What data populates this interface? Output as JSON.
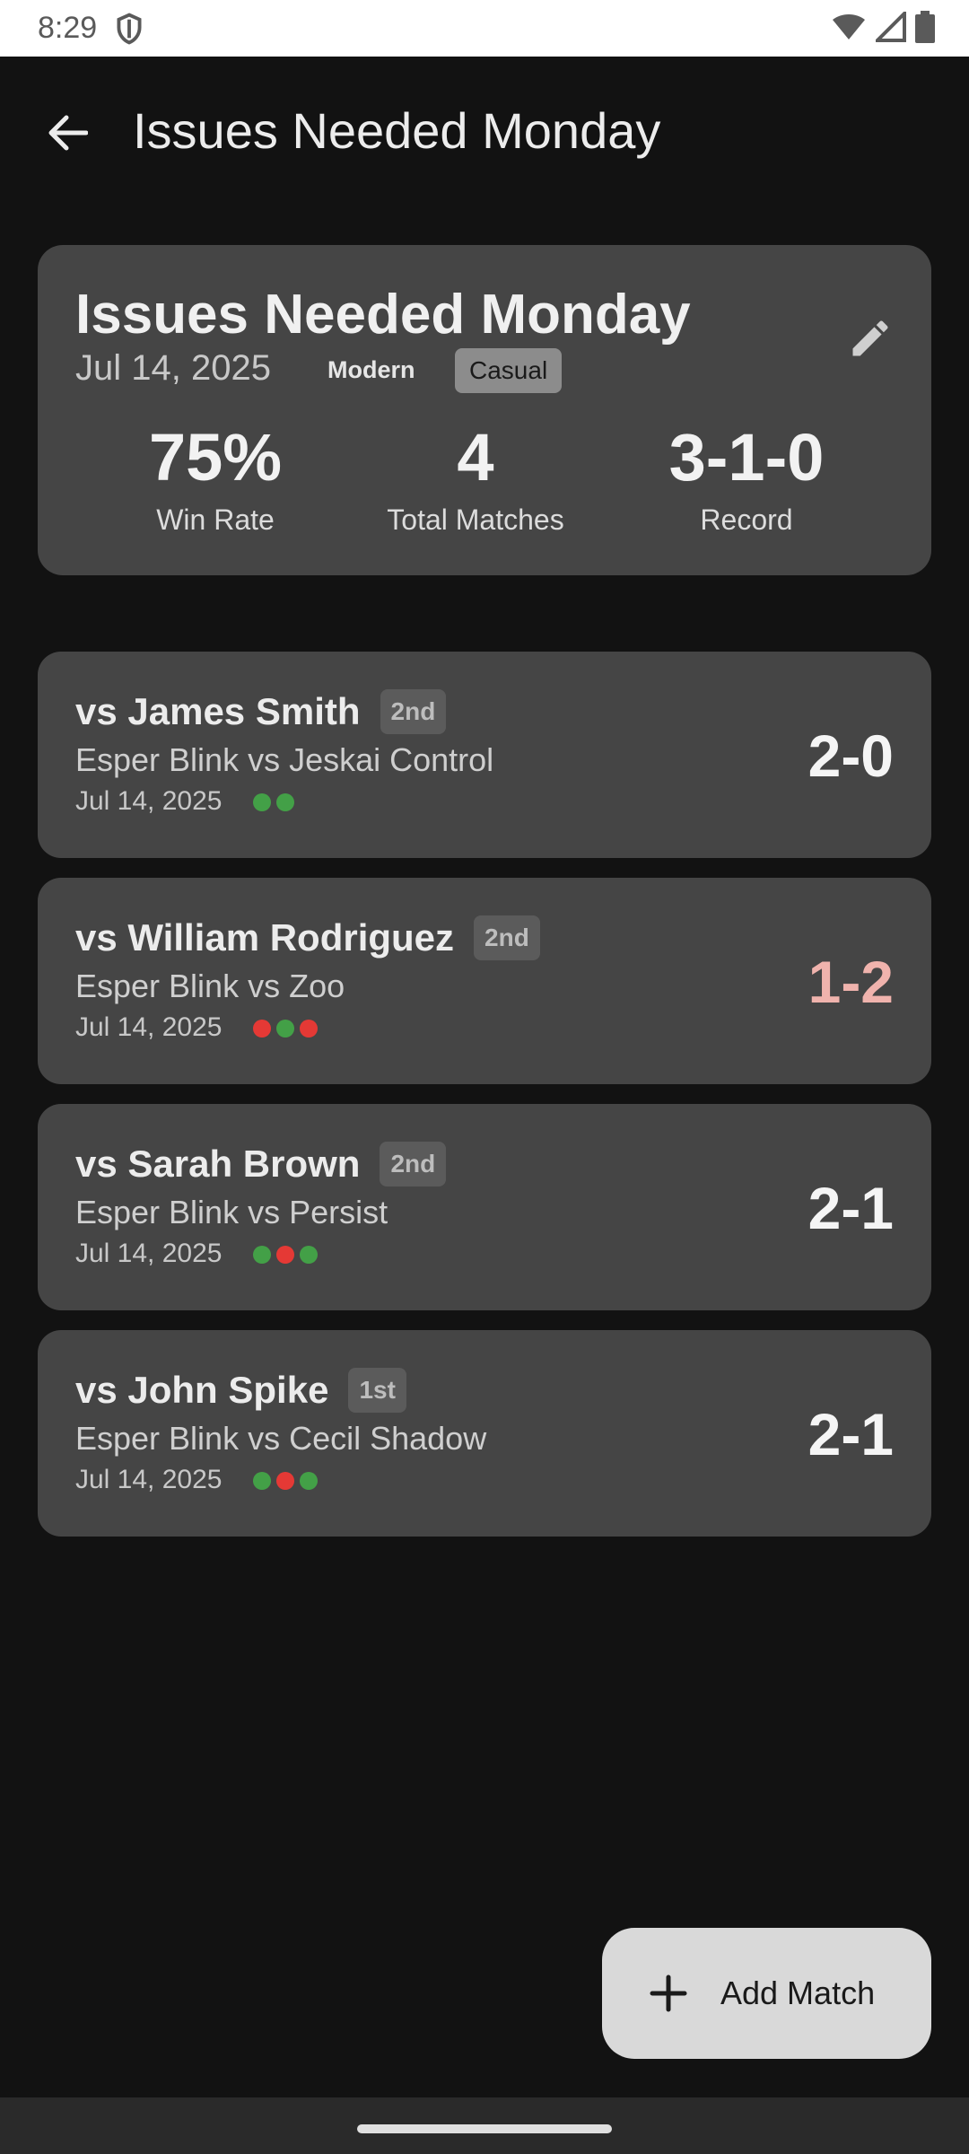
{
  "status_bar": {
    "time": "8:29"
  },
  "app_bar": {
    "title": "Issues Needed Monday"
  },
  "summary": {
    "title": "Issues Needed Monday",
    "date": "Jul 14, 2025",
    "format": "Modern",
    "type_chip": "Casual",
    "stats": [
      {
        "value": "75%",
        "label": "Win Rate"
      },
      {
        "value": "4",
        "label": "Total Matches"
      },
      {
        "value": "3-1-0",
        "label": "Record"
      }
    ]
  },
  "colors": {
    "win": "#43a047",
    "loss": "#e53935"
  },
  "matches": [
    {
      "opponent": "vs James Smith",
      "order": "2nd",
      "decks": "Esper Blink vs Jeskai Control",
      "date": "Jul 14, 2025",
      "score": "2-0",
      "result": "win",
      "games": [
        "win",
        "win"
      ]
    },
    {
      "opponent": "vs William Rodriguez",
      "order": "2nd",
      "decks": "Esper Blink vs Zoo",
      "date": "Jul 14, 2025",
      "score": "1-2",
      "result": "loss",
      "games": [
        "loss",
        "win",
        "loss"
      ]
    },
    {
      "opponent": "vs Sarah Brown",
      "order": "2nd",
      "decks": "Esper Blink vs Persist",
      "date": "Jul 14, 2025",
      "score": "2-1",
      "result": "win",
      "games": [
        "win",
        "loss",
        "win"
      ]
    },
    {
      "opponent": "vs John Spike",
      "order": "1st",
      "decks": "Esper Blink vs Cecil Shadow",
      "date": "Jul 14, 2025",
      "score": "2-1",
      "result": "win",
      "games": [
        "win",
        "loss",
        "win"
      ]
    }
  ],
  "fab": {
    "label": "Add Match"
  }
}
